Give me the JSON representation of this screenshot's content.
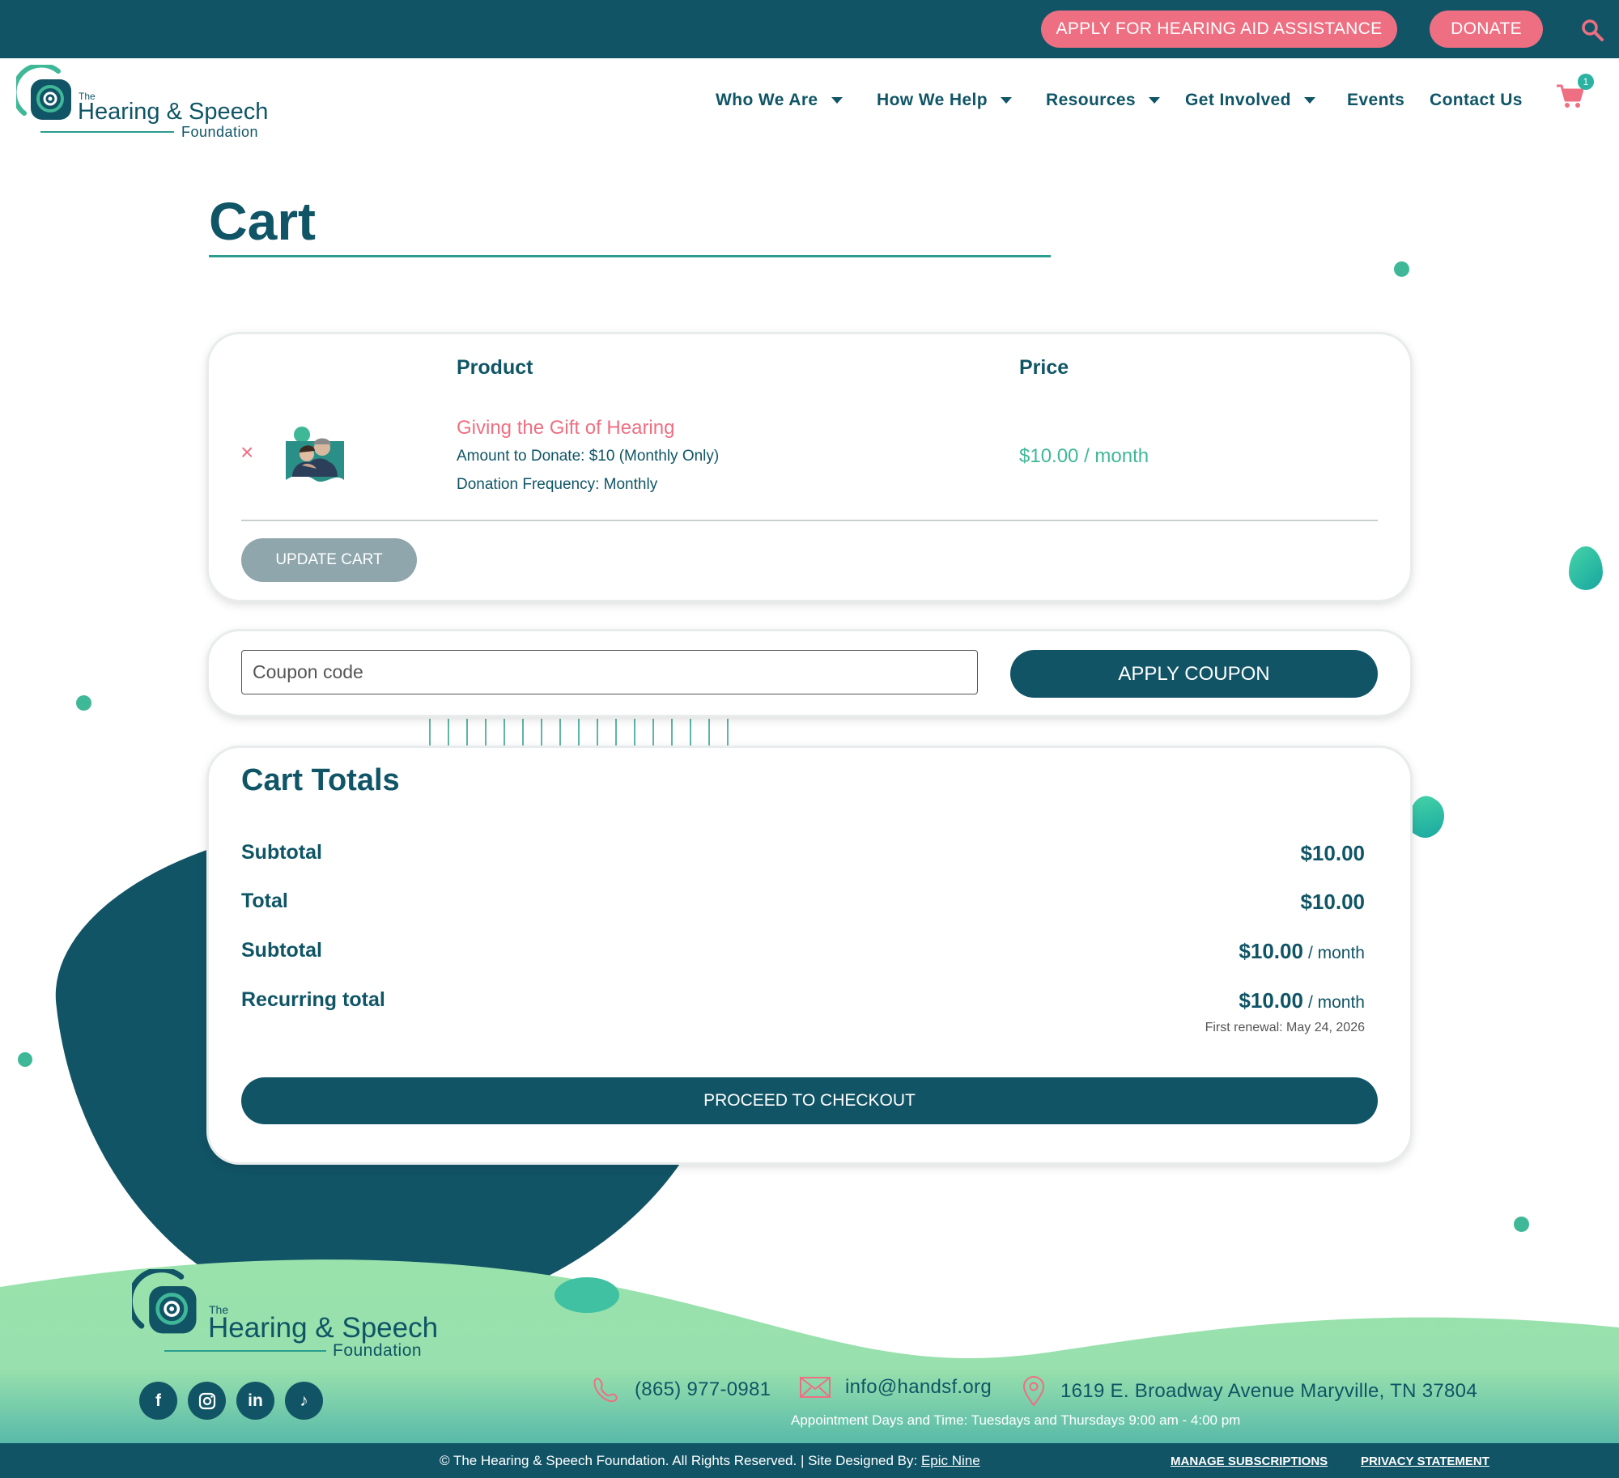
{
  "colors": {
    "primary": "#115466",
    "accent_pink": "#ef6f82",
    "accent_green": "#3fb898",
    "light_green": "#97e0ad"
  },
  "topbar": {
    "apply_label": "APPLY FOR HEARING AID ASSISTANCE",
    "donate_label": "DONATE",
    "search_icon": "search-icon"
  },
  "header": {
    "logo": {
      "the": "The",
      "name": "Hearing & Speech",
      "foundation": "Foundation"
    },
    "nav": [
      "Who We Are",
      "How We Help",
      "Resources",
      "Get Involved",
      "Events",
      "Contact Us"
    ],
    "cart_count": "1"
  },
  "page": {
    "title": "Cart"
  },
  "cart": {
    "headers": {
      "product": "Product",
      "price": "Price"
    },
    "item": {
      "remove": "×",
      "name": "Giving the Gift of Hearing",
      "amount": "Amount to Donate: $10 (Monthly Only)",
      "frequency": "Donation Frequency: Monthly",
      "price": "$10.00 / month"
    },
    "update_label": "UPDATE CART"
  },
  "coupon": {
    "placeholder": "Coupon code",
    "apply_label": "APPLY COUPON"
  },
  "totals": {
    "title": "Cart Totals",
    "rows": [
      {
        "label": "Subtotal",
        "value": "$10.00",
        "per": ""
      },
      {
        "label": "Total",
        "value": "$10.00",
        "per": ""
      },
      {
        "label": "Subtotal",
        "value": "$10.00",
        "per": "/ month"
      },
      {
        "label": "Recurring total",
        "value": "$10.00",
        "per": "/ month"
      }
    ],
    "renewal": "First renewal: May 24, 2026",
    "checkout_label": "PROCEED TO CHECKOUT"
  },
  "footer": {
    "logo": {
      "the": "The",
      "name": "Hearing & Speech",
      "foundation": "Foundation"
    },
    "social": [
      "facebook-icon",
      "instagram-icon",
      "linkedin-icon",
      "tiktok-icon"
    ],
    "phone": "(865) 977-0981",
    "email": "info@handsf.org",
    "address": "1619 E. Broadway Avenue Maryville, TN 37804",
    "hours": "Appointment Days and Time: Tuesdays and Thursdays 9:00 am - 4:00 pm",
    "copyright": "© The Hearing & Speech Foundation. All Rights Reserved. | Site Designed By: ",
    "designer": "Epic Nine",
    "manage_subscriptions": "MANAGE SUBSCRIPTIONS",
    "privacy": "PRIVACY STATEMENT"
  }
}
